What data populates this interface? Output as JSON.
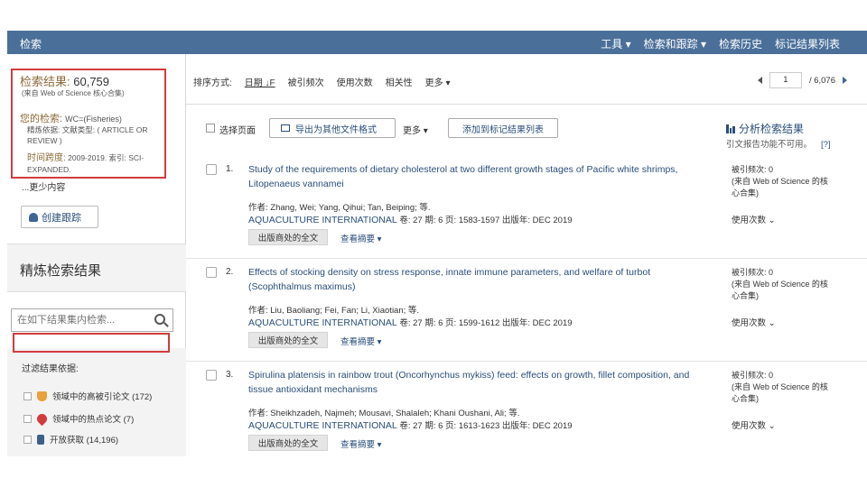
{
  "nav": {
    "brand": "检索",
    "menu": [
      "工具 ▾",
      "检索和跟踪 ▾",
      "检索历史",
      "标记结果列表"
    ]
  },
  "sidebar": {
    "results_label": "检索结果:",
    "results_count": "60,759",
    "results_source": "(来自 Web of Science 核心合集)",
    "query_label": "您的检索:",
    "query_value": "WC=(Fisheries)",
    "query_line2": "精炼依据: 文献类型: ( ARTICLE OR REVIEW )",
    "query_line3_key": "时间跨度:",
    "query_line3_val": " 2009-2019. 索引: SCI-EXPANDED.",
    "more_link": "...更少内容",
    "track_button": "创建跟踪",
    "refine_heading": "精炼检索结果",
    "refine_placeholder": "在如下结果集内检索...",
    "filter_label": "过滤结果依据:",
    "filters": [
      {
        "icon": "trophy-icon",
        "label": "领域中的高被引论文 (172)"
      },
      {
        "icon": "fire-icon",
        "label": "领域中的热点论文 (7)"
      },
      {
        "icon": "lock-icon",
        "label": "开放获取 (14,196)"
      }
    ]
  },
  "sortbar": {
    "label": "排序方式:",
    "options": [
      "日期 ↓F",
      "被引频次",
      "使用次数",
      "相关性",
      "更多 ▾"
    ],
    "page": "1",
    "total_pages": "/ 6,076"
  },
  "toolbar": {
    "select_page": "选择页面",
    "export": "导出为其他文件格式",
    "more": "更多 ▾",
    "add_marked": "添加到标记结果列表"
  },
  "analyze": {
    "label": "分析检索结果",
    "cite_note": "引文报告功能不可用。",
    "help": "[?]"
  },
  "records": [
    {
      "num": "1.",
      "title": "Study of the requirements of dietary cholesterol at two different growth stages of Pacific white shrimps, Litopenaeus vannamei",
      "authors": "作者: Zhang, Wei; Yang, Qihui; Tan, Beiping; 等.",
      "journal": "AQUACULTURE INTERNATIONAL",
      "details": "卷: 27  期: 6  页: 1583-1597  出版年: DEC 2019",
      "fulltext": "出版商处的全文",
      "abstract": "查看摘要 ▾",
      "times_cited": "被引频次: 0",
      "times_source": "(来自 Web of Science 的核心合集)",
      "usage": "使用次数 ⌄"
    },
    {
      "num": "2.",
      "title": "Effects of stocking density on stress response, innate immune parameters, and welfare of turbot (Scophthalmus maximus)",
      "authors": "作者: Liu, Baoliang; Fei, Fan; Li, Xiaotian; 等.",
      "journal": "AQUACULTURE INTERNATIONAL",
      "details": "卷: 27  期: 6  页: 1599-1612  出版年: DEC 2019",
      "fulltext": "出版商处的全文",
      "abstract": "查看摘要 ▾",
      "times_cited": "被引频次: 0",
      "times_source": "(来自 Web of Science 的核心合集)",
      "usage": "使用次数 ⌄"
    },
    {
      "num": "3.",
      "title": "Spirulina platensis in rainbow trout (Oncorhynchus mykiss) feed: effects on growth, fillet composition, and tissue antioxidant mechanisms",
      "authors": "作者: Sheikhzadeh, Najmeh; Mousavi, Shalaleh; Khani Oushani, Ali; 等.",
      "journal": "AQUACULTURE INTERNATIONAL",
      "details": "卷: 27  期: 6  页: 1613-1623  出版年: DEC 2019",
      "fulltext": "出版商处的全文",
      "abstract": "查看摘要 ▾",
      "times_cited": "被引频次: 0",
      "times_source": "(来自 Web of Science 的核心合集)",
      "usage": "使用次数 ⌄"
    }
  ]
}
